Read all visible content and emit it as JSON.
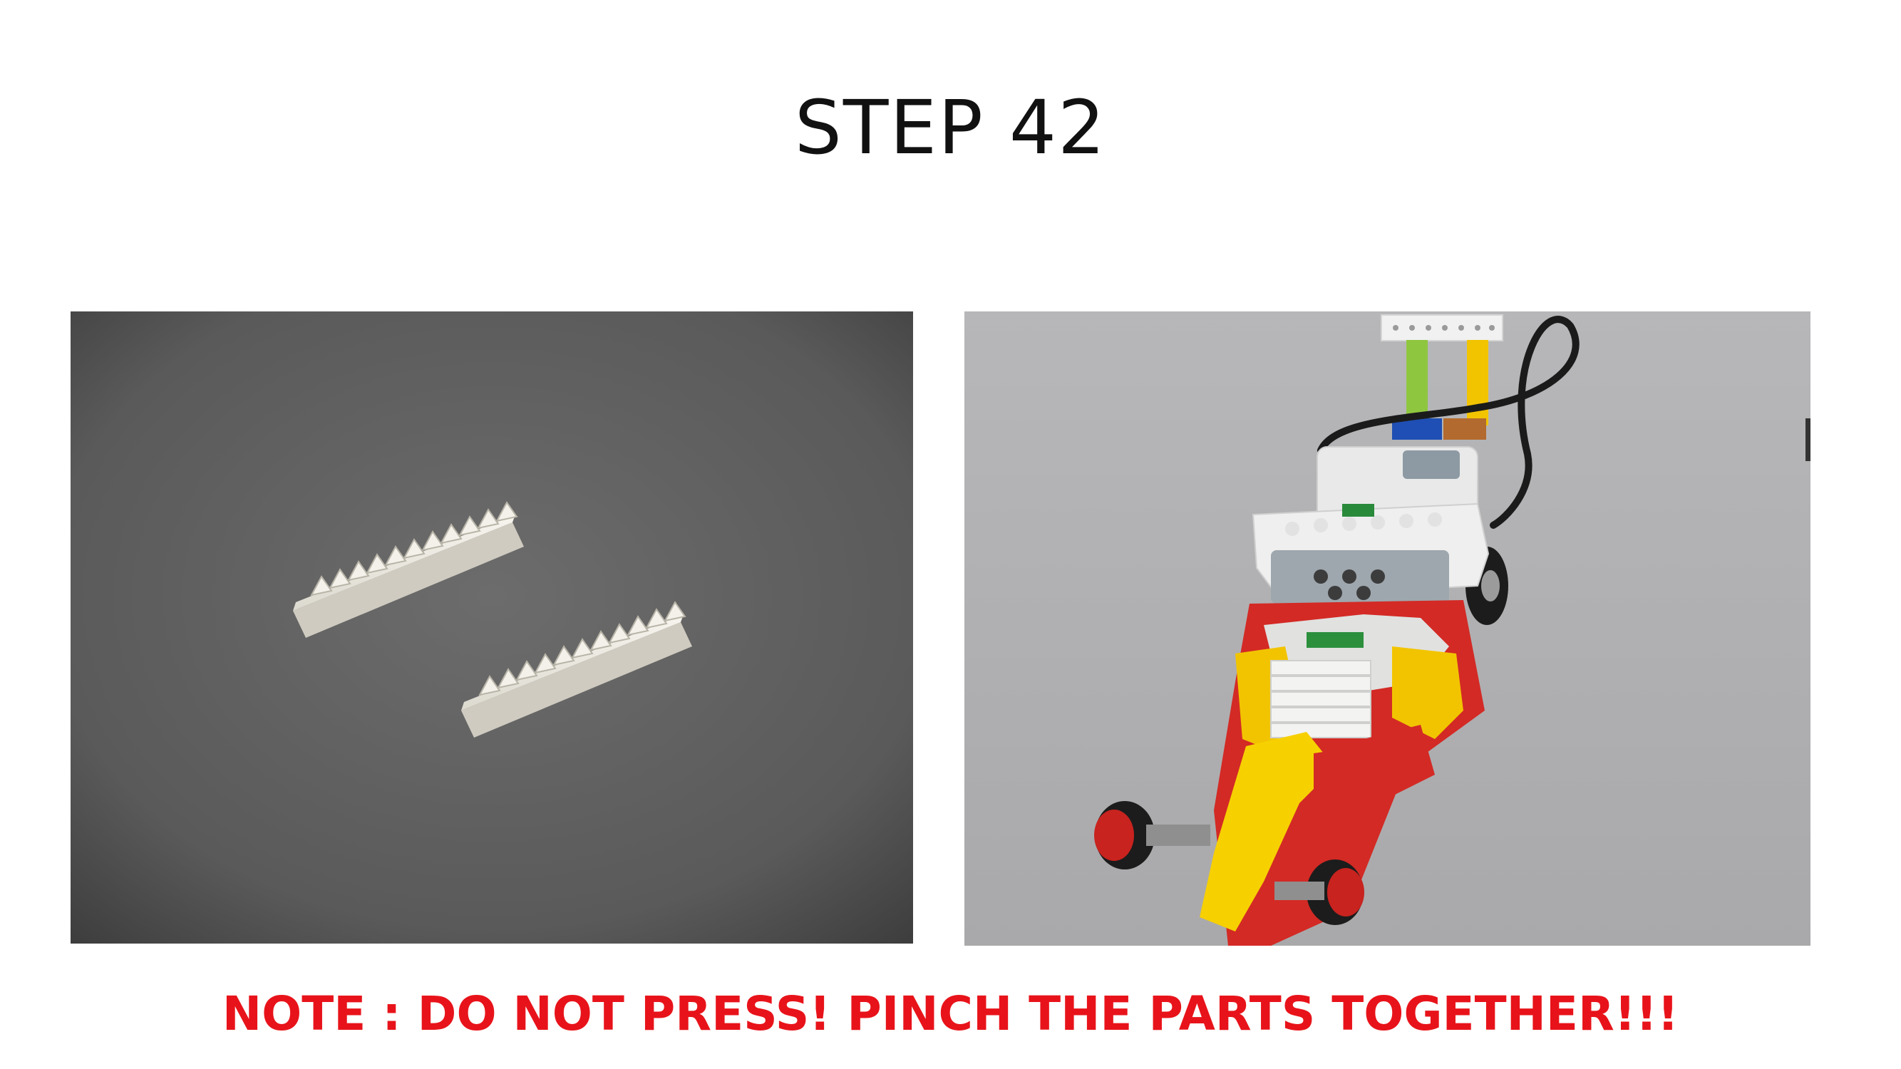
{
  "slide": {
    "title": "STEP 42",
    "note": "NOTE : DO NOT PRESS! PINCH THE PARTS TOGETHER!!!"
  },
  "photos": [
    {
      "name": "two white gear racks on grey surface",
      "background": "#5f5f5f"
    },
    {
      "name": "lego wedo dragster model with hub",
      "background": "#b4b4b4"
    }
  ],
  "colors": {
    "title": "#111111",
    "note": "#e8131a",
    "page_background": "#ffffff"
  }
}
